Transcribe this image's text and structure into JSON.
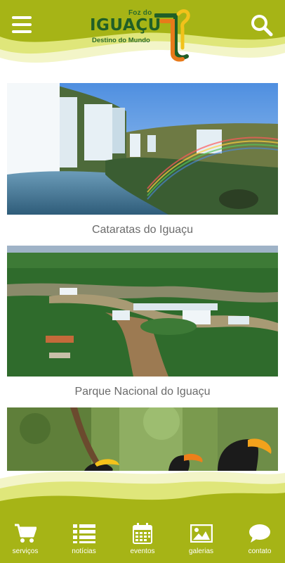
{
  "header": {
    "logo_top": "Foz do",
    "logo_main": "IGUAÇU",
    "logo_sub": "Destino do Mundo",
    "menu_icon": "hamburger-menu-icon",
    "search_icon": "search-icon"
  },
  "colors": {
    "brand_green": "#a6b416",
    "brand_light": "#dfe67a",
    "logo_dark": "#1f5f27",
    "logo_orange": "#e87a1a",
    "logo_yellow": "#f2c21a",
    "text_gray": "#6b6b6b"
  },
  "cards": [
    {
      "title": "Cataratas do Iguaçu",
      "image": "waterfalls-with-rainbow"
    },
    {
      "title": "Parque Nacional do Iguaçu",
      "image": "aerial-view-of-falls-and-forest"
    },
    {
      "title": "",
      "image": "toucans-in-forest"
    }
  ],
  "nav": [
    {
      "label": "serviços",
      "icon": "shopping-cart-icon"
    },
    {
      "label": "notícias",
      "icon": "list-icon"
    },
    {
      "label": "eventos",
      "icon": "calendar-icon"
    },
    {
      "label": "galerias",
      "icon": "image-icon"
    },
    {
      "label": "contato",
      "icon": "chat-bubble-icon"
    }
  ]
}
